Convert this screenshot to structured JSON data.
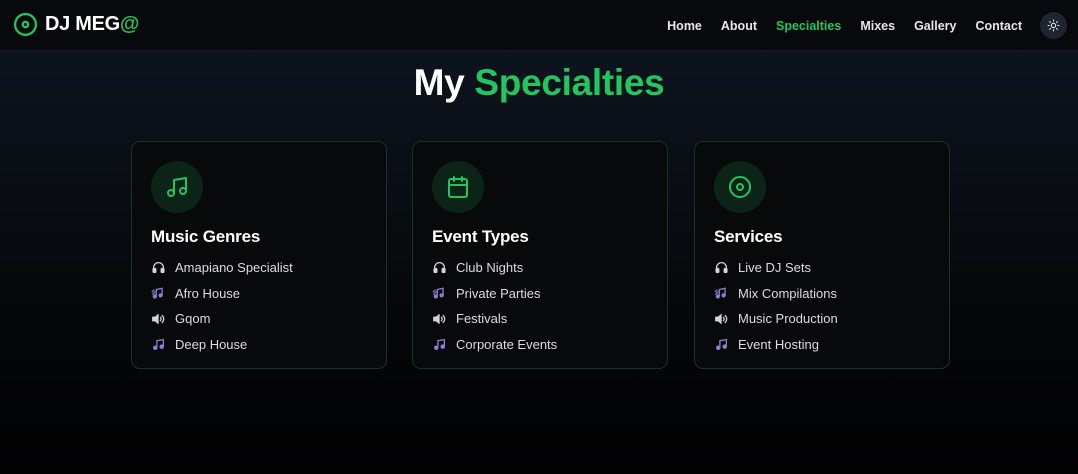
{
  "brand": {
    "name": "DJ MEG",
    "accent": "@"
  },
  "nav": {
    "items": [
      "Home",
      "About",
      "Specialties",
      "Mixes",
      "Gallery",
      "Contact"
    ],
    "active": "Specialties"
  },
  "heading": {
    "prefix": "My",
    "accent": "Specialties"
  },
  "colors": {
    "accent": "#22c55e",
    "list_icon_muted": "#d1d5db",
    "list_icon_purple": "#8b7fd1"
  },
  "cards": [
    {
      "icon": "music-note-icon",
      "title": "Music Genres",
      "items": [
        {
          "icon": "headphones-icon",
          "text": "Amapiano Specialist"
        },
        {
          "icon": "music-wave-icon",
          "text": "Afro House"
        },
        {
          "icon": "speaker-icon",
          "text": "Gqom"
        },
        {
          "icon": "music-notes-icon",
          "text": "Deep House"
        }
      ]
    },
    {
      "icon": "calendar-icon",
      "title": "Event Types",
      "items": [
        {
          "icon": "headphones-icon",
          "text": "Club Nights"
        },
        {
          "icon": "music-wave-icon",
          "text": "Private Parties"
        },
        {
          "icon": "speaker-icon",
          "text": "Festivals"
        },
        {
          "icon": "music-notes-icon",
          "text": "Corporate Events"
        }
      ]
    },
    {
      "icon": "disc-icon",
      "title": "Services",
      "items": [
        {
          "icon": "headphones-icon",
          "text": "Live DJ Sets"
        },
        {
          "icon": "music-wave-icon",
          "text": "Mix Compilations"
        },
        {
          "icon": "speaker-icon",
          "text": "Music Production"
        },
        {
          "icon": "music-notes-icon",
          "text": "Event Hosting"
        }
      ]
    }
  ]
}
